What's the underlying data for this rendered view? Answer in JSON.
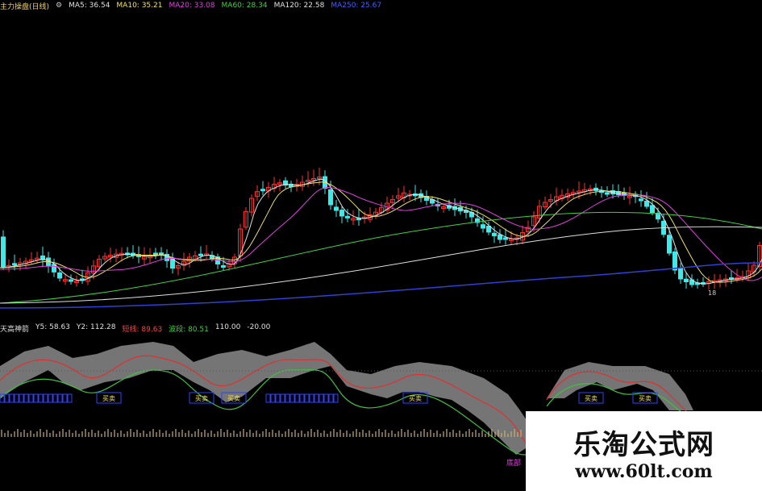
{
  "top_header": {
    "title": "主力操盘(日线)",
    "gear": "⚙",
    "ma_items": [
      {
        "label": "MA5",
        "value": "36.54",
        "color": "#e0e0e0"
      },
      {
        "label": "MA10",
        "value": "35.21",
        "color": "#f0e060"
      },
      {
        "label": "MA20",
        "value": "33.08",
        "color": "#e040e0"
      },
      {
        "label": "MA60",
        "value": "28.34",
        "color": "#40d040"
      },
      {
        "label": "MA120",
        "value": "22.58",
        "color": "#e0e0e0"
      },
      {
        "label": "MA250",
        "value": "25.67",
        "color": "#4060ff"
      }
    ]
  },
  "indicator_header": {
    "title": "天高神箭",
    "items": [
      {
        "label": "Y5",
        "value": "58.63",
        "color": "#e0e0e0"
      },
      {
        "label": "Y2",
        "value": "112.28",
        "color": "#e0e0e0"
      },
      {
        "label": "短线",
        "value": "89.63",
        "color": "#ff4040"
      },
      {
        "label": "波段",
        "value": "80.51",
        "color": "#40d040"
      },
      {
        "label": "",
        "value": "110.00",
        "color": "#e0e0e0"
      },
      {
        "label": "",
        "value": "-20.00",
        "color": "#e0e0e0"
      }
    ]
  },
  "indicator_labels": {
    "buy": "买卖",
    "low": "底部"
  },
  "watermark": {
    "title": "乐淘公式网",
    "url": "www.60lt.com"
  },
  "colors": {
    "up": "#ff3030",
    "down": "#40e8e8",
    "ma5": "#e0e0e0",
    "ma10": "#f0e060",
    "ma20": "#e040e0",
    "ma60": "#40d040",
    "ma120": "#e0e0e0",
    "ma250": "#3040d0",
    "band": "#8a8a8a",
    "box": "#3040ff"
  },
  "main_axis_label": "18"
}
